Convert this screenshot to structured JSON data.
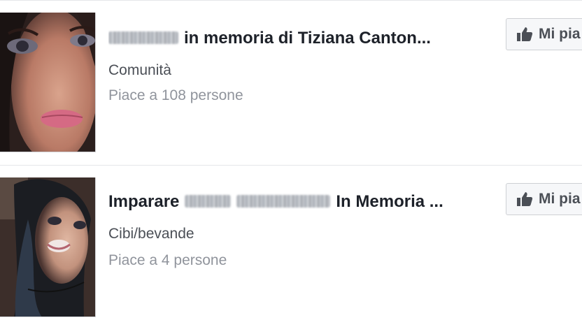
{
  "results": [
    {
      "title_visible": "in memoria di Tiziana Canton...",
      "category": "Comunità",
      "likes": "Piace a 108 persone",
      "like_button_label": "Mi pia"
    },
    {
      "title_start": "Imparare",
      "title_end": "In Memoria ...",
      "category": "Cibi/bevande",
      "likes": "Piace a 4 persone",
      "like_button_label": "Mi pia"
    }
  ],
  "icons": {
    "like": "thumbs-up-icon"
  },
  "colors": {
    "title": "#1d2129",
    "category": "#4b4f56",
    "likes": "#90949c",
    "button_bg": "#f6f7f9",
    "divider": "#e5e6e9"
  }
}
